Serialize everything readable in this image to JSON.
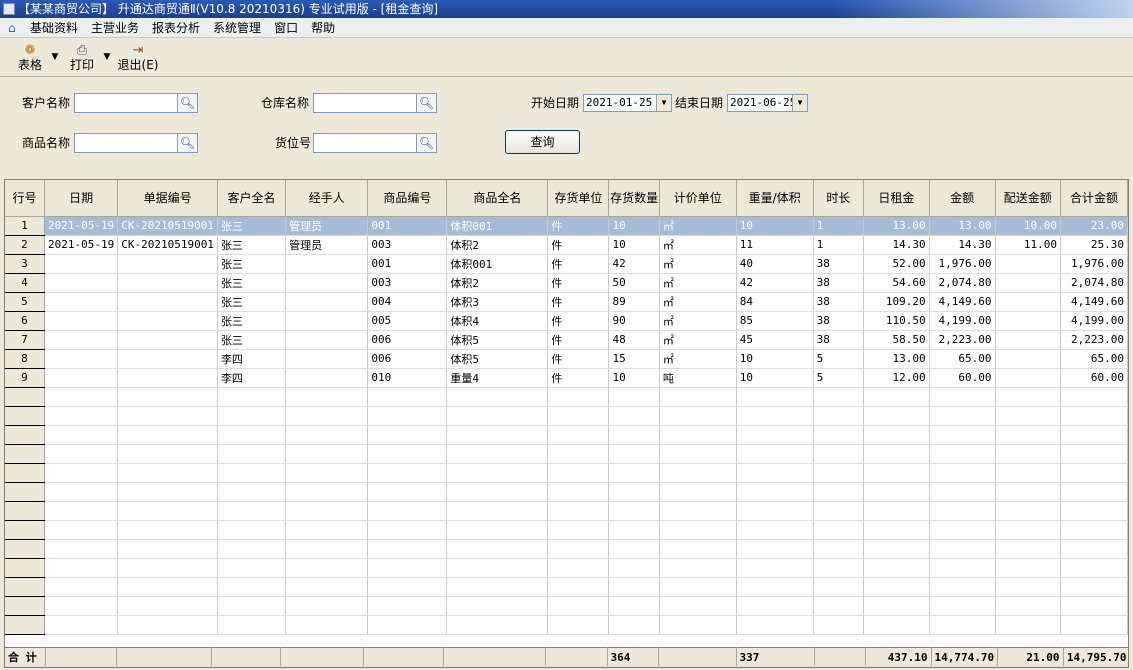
{
  "window": {
    "title": "【某某商贸公司】 升通达商贸通Ⅱ(V10.8 20210316) 专业试用版 - [租金查询]"
  },
  "menu": {
    "items": [
      "基础资料",
      "主营业务",
      "报表分析",
      "系统管理",
      "窗口",
      "帮助"
    ]
  },
  "toolbar": {
    "table_label": "表格",
    "print_label": "打印",
    "exit_label": "退出(E)"
  },
  "filters": {
    "customer_label": "客户名称",
    "customer_value": "",
    "warehouse_label": "仓库名称",
    "warehouse_value": "",
    "product_label": "商品名称",
    "product_value": "",
    "location_label": "货位号",
    "location_value": "",
    "start_label": "开始日期",
    "start_value": "2021-01-25",
    "end_label": "结束日期",
    "end_value": "2021-06-25",
    "query_label": "查询"
  },
  "table": {
    "columns": [
      "行号",
      "日期",
      "单据编号",
      "客户全名",
      "经手人",
      "商品编号",
      "商品全名",
      "存货单位",
      "存货数量",
      "计价单位",
      "重量/体积",
      "时长",
      "日租金",
      "金额",
      "配送金额",
      "合计金额"
    ],
    "rows": [
      [
        "1",
        "2021-05-19",
        "CK-20210519001",
        "张三",
        "管理员",
        "001",
        "体积001",
        "件",
        "10",
        "㎡",
        "10",
        "1",
        "13.00",
        "13.00",
        "10.00",
        "23.00"
      ],
      [
        "2",
        "2021-05-19",
        "CK-20210519001",
        "张三",
        "管理员",
        "003",
        "体积2",
        "件",
        "10",
        "㎡",
        "11",
        "1",
        "14.30",
        "14.30",
        "11.00",
        "25.30"
      ],
      [
        "3",
        "",
        "",
        "张三",
        "",
        "001",
        "体积001",
        "件",
        "42",
        "㎡",
        "40",
        "38",
        "52.00",
        "1,976.00",
        "",
        "1,976.00"
      ],
      [
        "4",
        "",
        "",
        "张三",
        "",
        "003",
        "体积2",
        "件",
        "50",
        "㎡",
        "42",
        "38",
        "54.60",
        "2,074.80",
        "",
        "2,074.80"
      ],
      [
        "5",
        "",
        "",
        "张三",
        "",
        "004",
        "体积3",
        "件",
        "89",
        "㎡",
        "84",
        "38",
        "109.20",
        "4,149.60",
        "",
        "4,149.60"
      ],
      [
        "6",
        "",
        "",
        "张三",
        "",
        "005",
        "体积4",
        "件",
        "90",
        "㎡",
        "85",
        "38",
        "110.50",
        "4,199.00",
        "",
        "4,199.00"
      ],
      [
        "7",
        "",
        "",
        "张三",
        "",
        "006",
        "体积5",
        "件",
        "48",
        "㎡",
        "45",
        "38",
        "58.50",
        "2,223.00",
        "",
        "2,223.00"
      ],
      [
        "8",
        "",
        "",
        "李四",
        "",
        "006",
        "体积5",
        "件",
        "15",
        "㎡",
        "10",
        "5",
        "13.00",
        "65.00",
        "",
        "65.00"
      ],
      [
        "9",
        "",
        "",
        "李四",
        "",
        "010",
        "重量4",
        "件",
        "10",
        "吨",
        "10",
        "5",
        "12.00",
        "60.00",
        "",
        "60.00"
      ]
    ],
    "totals": [
      "合 计",
      "",
      "",
      "",
      "",
      "",
      "",
      "",
      "364",
      "",
      "337",
      "",
      "437.10",
      "14,774.70",
      "21.00",
      "14,795.70"
    ]
  }
}
